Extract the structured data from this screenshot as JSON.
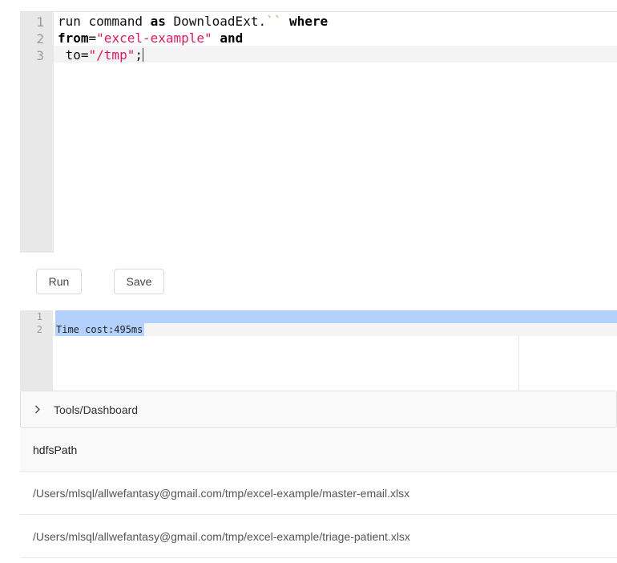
{
  "editor": {
    "line_numbers": [
      "1",
      "2",
      "3"
    ],
    "lines": [
      [
        "run command ",
        "as",
        " DownloadExt.",
        "``",
        " ",
        "where"
      ],
      [
        "from",
        "=",
        "\"excel-example\"",
        " ",
        "and"
      ],
      [
        " to=",
        "\"/tmp\"",
        ";"
      ]
    ]
  },
  "buttons": {
    "run": "Run",
    "save": "Save"
  },
  "output": {
    "line_numbers": [
      "1",
      "2"
    ],
    "line_2": "Time cost:495ms"
  },
  "panel": {
    "title": "Tools/Dashboard",
    "icon": "chevron-right-icon"
  },
  "table": {
    "header": "hdfsPath",
    "rows": [
      "/Users/mlsql/allwefantasy@gmail.com/tmp/excel-example/master-email.xlsx",
      "/Users/mlsql/allwefantasy@gmail.com/tmp/excel-example/triage-patient.xlsx"
    ]
  },
  "colors": {
    "string": "#d81b60",
    "selection": "#b3d1fb",
    "gutter": "#e8e8e8"
  }
}
